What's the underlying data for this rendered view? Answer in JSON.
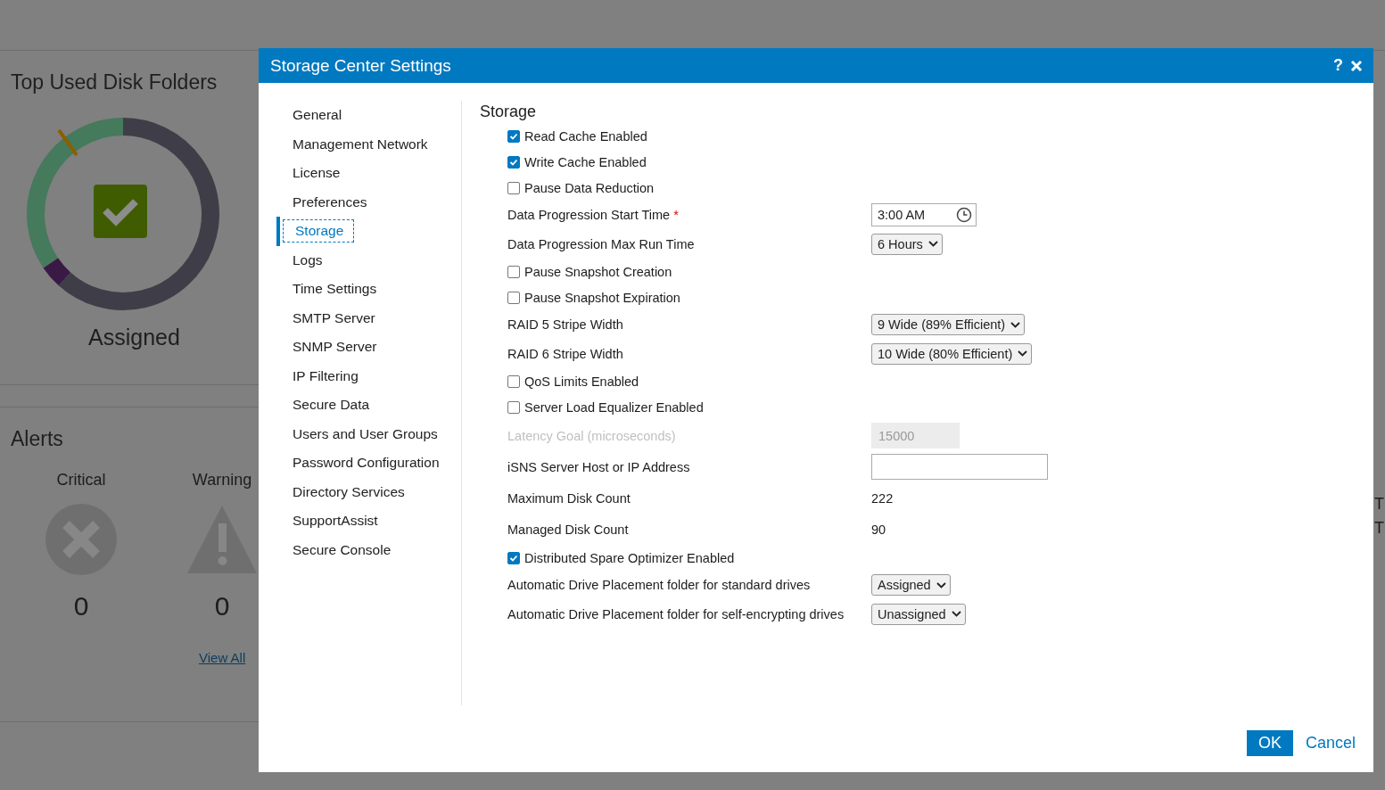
{
  "background": {
    "disk_panel": {
      "title": "Top Used Disk Folders",
      "caption": "Assigned"
    },
    "alerts": {
      "title": "Alerts",
      "items": [
        {
          "kind": "critical",
          "label": "Critical",
          "count": "0"
        },
        {
          "kind": "warning",
          "label": "Warning",
          "count": "0"
        }
      ],
      "link": "View All"
    },
    "right_edge": [
      "T",
      "T"
    ]
  },
  "dialog": {
    "title": "Storage Center Settings",
    "help": "?",
    "nav": [
      {
        "label": "General",
        "selected": false
      },
      {
        "label": "Management Network",
        "selected": false
      },
      {
        "label": "License",
        "selected": false
      },
      {
        "label": "Preferences",
        "selected": false
      },
      {
        "label": "Storage",
        "selected": true
      },
      {
        "label": "Logs",
        "selected": false
      },
      {
        "label": "Time Settings",
        "selected": false
      },
      {
        "label": "SMTP Server",
        "selected": false
      },
      {
        "label": "SNMP Server",
        "selected": false
      },
      {
        "label": "IP Filtering",
        "selected": false
      },
      {
        "label": "Secure Data",
        "selected": false
      },
      {
        "label": "Users and User Groups",
        "selected": false
      },
      {
        "label": "Password Configuration",
        "selected": false
      },
      {
        "label": "Directory Services",
        "selected": false
      },
      {
        "label": "SupportAssist",
        "selected": false
      },
      {
        "label": "Secure Console",
        "selected": false
      }
    ],
    "section": "Storage",
    "rows": [
      {
        "kind": "checkbox",
        "label": "Read Cache Enabled",
        "checked": true
      },
      {
        "kind": "checkbox",
        "label": "Write Cache Enabled",
        "checked": true
      },
      {
        "kind": "checkbox",
        "label": "Pause Data Reduction",
        "checked": false
      },
      {
        "kind": "time",
        "label": "Data Progression Start Time",
        "required": true,
        "required_mark": "*",
        "value": "3:00 AM"
      },
      {
        "kind": "select",
        "label": "Data Progression Max Run Time",
        "value": "6 Hours"
      },
      {
        "kind": "checkbox",
        "label": "Pause Snapshot Creation",
        "checked": false
      },
      {
        "kind": "checkbox",
        "label": "Pause Snapshot Expiration",
        "checked": false
      },
      {
        "kind": "select",
        "label": "RAID 5 Stripe Width",
        "value": "9 Wide (89% Efficient)"
      },
      {
        "kind": "select",
        "label": "RAID 6 Stripe Width",
        "value": "10 Wide (80% Efficient)"
      },
      {
        "kind": "checkbox",
        "label": "QoS Limits Enabled",
        "checked": false
      },
      {
        "kind": "checkbox",
        "label": "Server Load Equalizer Enabled",
        "checked": false
      },
      {
        "kind": "input",
        "label": "Latency Goal (microseconds)",
        "placeholder": "15000",
        "disabled": true
      },
      {
        "kind": "input",
        "label": "iSNS Server Host or IP Address",
        "disabled": false
      },
      {
        "kind": "text",
        "label": "Maximum Disk Count",
        "value": "222"
      },
      {
        "kind": "text",
        "label": "Managed Disk Count",
        "value": "90"
      },
      {
        "kind": "checkbox",
        "label": "Distributed Spare Optimizer Enabled",
        "checked": true
      },
      {
        "kind": "select",
        "label": "Automatic Drive Placement folder for standard drives",
        "value": "Assigned"
      },
      {
        "kind": "select",
        "label": "Automatic Drive Placement folder for self-encrypting drives",
        "value": "Unassigned"
      }
    ],
    "buttons": [
      {
        "kind": "primary",
        "label": "OK"
      },
      {
        "kind": "link",
        "label": "Cancel"
      }
    ]
  }
}
